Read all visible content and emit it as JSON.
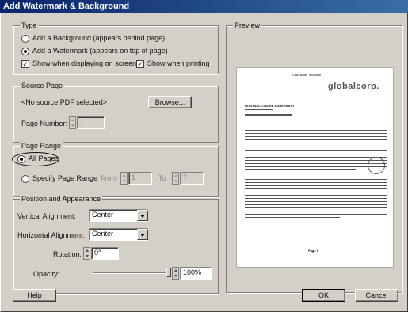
{
  "window": {
    "title": "Add Watermark & Background"
  },
  "type_group": {
    "legend": "Type",
    "add_background": "Add a Background (appears behind page)",
    "add_watermark": "Add a Watermark (appears on top of page)",
    "show_on_screen": "Show when displaying on screen",
    "show_printing": "Show when printing",
    "selected": "add_watermark",
    "show_on_screen_checked": true,
    "show_printing_checked": true
  },
  "source_group": {
    "legend": "Source Page",
    "no_source": "<No source PDF selected>",
    "browse": "Browse...",
    "page_number_label": "Page Number:",
    "page_number_value": "1"
  },
  "range_group": {
    "legend": "Page Range",
    "all_pages": "All Pages",
    "specify_range": "Specify Page Range",
    "from_label": "From",
    "from_value": "1",
    "to_label": "To",
    "to_value": "7",
    "selected": "all_pages"
  },
  "position_group": {
    "legend": "Position and Appearance",
    "vertical_label": "Vertical Alignment:",
    "vertical_value": "Center",
    "horizontal_label": "Horizontal Alignment:",
    "horizontal_value": "Center",
    "rotation_label": "Rotation:",
    "rotation_value": "0°",
    "opacity_label": "Opacity:",
    "opacity_value": "100%",
    "opacity_level": 1.0
  },
  "preview": {
    "legend": "Preview",
    "logo_text": "globalcorp.",
    "header_text": "Final Base Template",
    "doc_title": "NON-DISCLOSURE AGREEMENT",
    "footer_text": "Page 1"
  },
  "buttons": {
    "help": "Help",
    "ok": "OK",
    "cancel": "Cancel"
  }
}
